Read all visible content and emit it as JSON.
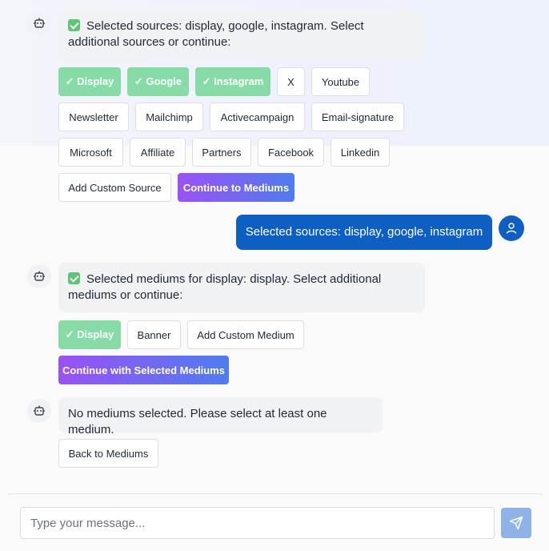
{
  "messages": {
    "bot1": {
      "text": "Selected sources: display, google, instagram. Select additional sources or continue:",
      "options": [
        {
          "label": "✓ Display",
          "state": "selected"
        },
        {
          "label": "✓ Google",
          "state": "selected"
        },
        {
          "label": "✓ Instagram",
          "state": "selected"
        },
        {
          "label": "X",
          "state": "default"
        },
        {
          "label": "Youtube",
          "state": "default"
        },
        {
          "label": "Newsletter",
          "state": "default"
        },
        {
          "label": "Mailchimp",
          "state": "default"
        },
        {
          "label": "Activecampaign",
          "state": "default"
        },
        {
          "label": "Email-signature",
          "state": "default"
        },
        {
          "label": "Microsoft",
          "state": "default"
        },
        {
          "label": "Affiliate",
          "state": "default"
        },
        {
          "label": "Partners",
          "state": "default"
        },
        {
          "label": "Facebook",
          "state": "default"
        },
        {
          "label": "Linkedin",
          "state": "default"
        },
        {
          "label": "Add Custom Source",
          "state": "default"
        },
        {
          "label": "Continue to Mediums",
          "state": "primary"
        }
      ]
    },
    "user1": {
      "text": "Selected sources: display, google, instagram"
    },
    "bot2": {
      "text": "Selected mediums for display: display. Select additional mediums or continue:",
      "options": [
        {
          "label": "✓ Display",
          "state": "selected"
        },
        {
          "label": "Banner",
          "state": "default"
        },
        {
          "label": "Add Custom Medium",
          "state": "default"
        },
        {
          "label": "Continue with Selected Mediums",
          "state": "primary"
        }
      ]
    },
    "bot3": {
      "text": "No mediums selected. Please select at least one medium.",
      "options": [
        {
          "label": "Back to Mediums",
          "state": "default"
        }
      ]
    }
  },
  "composer": {
    "placeholder": "Type your message...",
    "send_icon": "send-icon"
  },
  "colors": {
    "user_bubble": "#0d5fc4",
    "selected_chip": "#86dba7",
    "primary_gradient_start": "#9b51f6",
    "primary_gradient_end": "#4f7cf0",
    "send_button": "#8fb3e8",
    "check_green": "#5ec476"
  }
}
